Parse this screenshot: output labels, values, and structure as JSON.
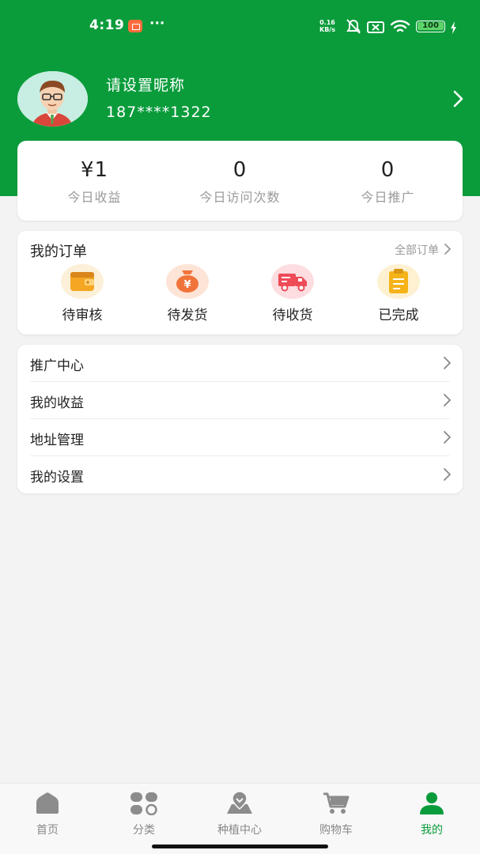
{
  "status_bar": {
    "time": "4:19",
    "dots": "···",
    "net_speed_value": "0.16",
    "net_speed_unit": "KB/s",
    "battery": "100"
  },
  "profile": {
    "nickname": "请设置昵称",
    "phone": "187****1322"
  },
  "stats": [
    {
      "value": "¥1",
      "label": "今日收益"
    },
    {
      "value": "0",
      "label": "今日访问次数"
    },
    {
      "value": "0",
      "label": "今日推广"
    }
  ],
  "orders": {
    "title": "我的订单",
    "all_label": "全部订单",
    "items": [
      {
        "label": "待审核",
        "icon": "wallet-icon",
        "color": "#f5a623"
      },
      {
        "label": "待发货",
        "icon": "money-bag-icon",
        "color": "#f0743a"
      },
      {
        "label": "待收货",
        "icon": "truck-icon",
        "color": "#ee4b57"
      },
      {
        "label": "已完成",
        "icon": "clipboard-icon",
        "color": "#f5b318"
      }
    ]
  },
  "menu": [
    {
      "label": "推广中心"
    },
    {
      "label": "我的收益"
    },
    {
      "label": "地址管理"
    },
    {
      "label": "我的设置"
    }
  ],
  "tabbar": [
    {
      "label": "首页",
      "icon": "home-icon",
      "active": false
    },
    {
      "label": "分类",
      "icon": "category-icon",
      "active": false
    },
    {
      "label": "种植中心",
      "icon": "map-pin-icon",
      "active": false
    },
    {
      "label": "购物车",
      "icon": "cart-icon",
      "active": false
    },
    {
      "label": "我的",
      "icon": "user-icon",
      "active": true
    }
  ],
  "colors": {
    "brand_green": "#0a9c3b",
    "tab_inactive": "#888888"
  }
}
